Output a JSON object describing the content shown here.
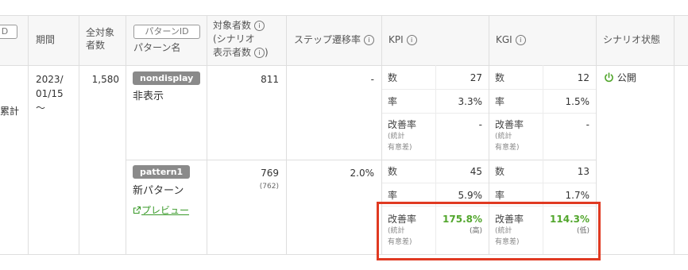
{
  "header": {
    "id_chip": "D",
    "period": "期間",
    "total_targets": "全対象\n者数",
    "pattern_chip": "パターンID",
    "pattern_name": "パターン名",
    "targets_line1": "対象者数",
    "targets_line2": "(シナリオ",
    "targets_line3": "表示者数",
    "step_rate": "ステップ遷移率",
    "kpi": "KPI",
    "kgi": "KGI",
    "scenario_status": "シナリオ状態",
    "info_glyph": "i"
  },
  "row": {
    "cumulative": "累計",
    "period_line1": "2023/",
    "period_line2": "01/15",
    "period_line3": "～",
    "total_targets": "1,580",
    "status_icon": "power-icon",
    "status": "公開"
  },
  "patterns": [
    {
      "tag": "nondisplay",
      "name": "非表示",
      "targets": "811",
      "targets_shown": "",
      "step_rate": "-",
      "kpi": {
        "count_label": "数",
        "count": "27",
        "rate_label": "率",
        "rate": "3.3%",
        "imp_label": "改善率",
        "imp_note1": "(統計",
        "imp_note2": "有意差)",
        "imp": "-",
        "imp_sig": ""
      },
      "kgi": {
        "count_label": "数",
        "count": "12",
        "rate_label": "率",
        "rate": "1.5%",
        "imp_label": "改善率",
        "imp_note1": "(統計",
        "imp_note2": "有意差)",
        "imp": "-",
        "imp_sig": ""
      }
    },
    {
      "tag": "pattern1",
      "name": "新パターン",
      "preview": "プレビュー",
      "targets": "769",
      "targets_shown": "(762)",
      "step_rate": "2.0%",
      "kpi": {
        "count_label": "数",
        "count": "45",
        "rate_label": "率",
        "rate": "5.9%",
        "imp_label": "改善率",
        "imp_note1": "(統計",
        "imp_note2": "有意差)",
        "imp": "175.8%",
        "imp_sig": "(高)"
      },
      "kgi": {
        "count_label": "数",
        "count": "13",
        "rate_label": "率",
        "rate": "1.7%",
        "imp_label": "改善率",
        "imp_note1": "(統計",
        "imp_note2": "有意差)",
        "imp": "114.3%",
        "imp_sig": "(低)"
      }
    }
  ],
  "colors": {
    "accent_green": "#52a62d",
    "highlight_red": "#e03a22",
    "tag_gray": "#8a8a8a"
  }
}
